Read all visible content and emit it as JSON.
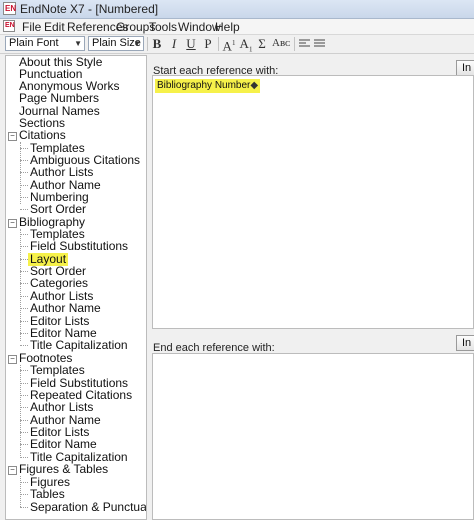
{
  "window": {
    "title": "EndNote X7 - [Numbered]",
    "app_icon_text": "EN"
  },
  "menu": {
    "items": [
      "File",
      "Edit",
      "References",
      "Groups",
      "Tools",
      "Window",
      "Help"
    ]
  },
  "toolbar": {
    "font": "Plain Font",
    "size": "Plain Size",
    "bold": "B",
    "italic": "I",
    "underline": "U",
    "plain": "P",
    "superscript": "A",
    "superscript_mark": "1",
    "subscript": "A",
    "subscript_mark": "1",
    "symbol": "Σ",
    "smallcaps": "Aʙᴄ"
  },
  "tree": {
    "top_items": [
      "About this Style",
      "Punctuation",
      "Anonymous Works",
      "Page Numbers",
      "Journal Names",
      "Sections"
    ],
    "citations": {
      "label": "Citations",
      "expander": "−",
      "children": [
        "Templates",
        "Ambiguous Citations",
        "Author Lists",
        "Author Name",
        "Numbering",
        "Sort Order"
      ]
    },
    "bibliography": {
      "label": "Bibliography",
      "expander": "−",
      "children": [
        "Templates",
        "Field Substitutions",
        "Layout",
        "Sort Order",
        "Categories",
        "Author Lists",
        "Author Name",
        "Editor Lists",
        "Editor Name",
        "Title Capitalization"
      ]
    },
    "footnotes": {
      "label": "Footnotes",
      "expander": "−",
      "children": [
        "Templates",
        "Field Substitutions",
        "Repeated Citations",
        "Author Lists",
        "Author Name",
        "Editor Lists",
        "Editor Name",
        "Title Capitalization"
      ]
    },
    "figures": {
      "label": "Figures & Tables",
      "expander": "−",
      "children": [
        "Figures",
        "Tables",
        "Separation & Punctuation"
      ]
    }
  },
  "start_pane": {
    "label": "Start each reference with:",
    "insert_button": "In",
    "content": "Bibliography Number"
  },
  "end_pane": {
    "label": "End each reference with:",
    "insert_button": "In"
  },
  "colors": {
    "highlight": "#f6f14a",
    "field_marker": "#333333"
  }
}
